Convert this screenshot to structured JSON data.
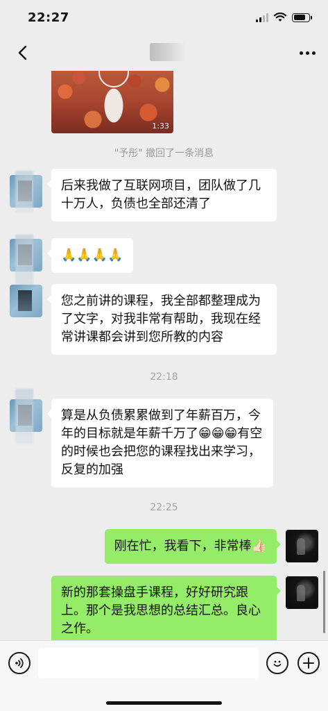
{
  "status_bar": {
    "time": "22:27"
  },
  "nav": {
    "back_icon": "chevron-left-icon",
    "more_icon": "more-dots-icon"
  },
  "video": {
    "duration": "1:33"
  },
  "messages": {
    "recall_notice": "\"予彤\" 撤回了一条消息",
    "m1": "后来我做了互联网项目，团队做了几十万人，负债也全部还清了",
    "m2": "🙏🙏🙏🙏",
    "m3": "您之前讲的课程，我全部都整理成为了文字，对我非常有帮助，我现在经常讲课都会讲到您所教的内容",
    "time1": "22:18",
    "m4": "算是从负债累累做到了年薪百万，今年的目标就是年薪千万了😁😁😁有空的时候也会把您的课程找出来学习，反复的加强",
    "time2": "22:25",
    "m5": "刚在忙，我看下，非常棒👍🏻",
    "m6": "新的那套操盘手课程，好好研究跟上。那个是我思想的总结汇总。良心之作。"
  },
  "colors": {
    "background": "#ededed",
    "sent_bubble": "#95ec69",
    "received_bubble": "#ffffff"
  }
}
